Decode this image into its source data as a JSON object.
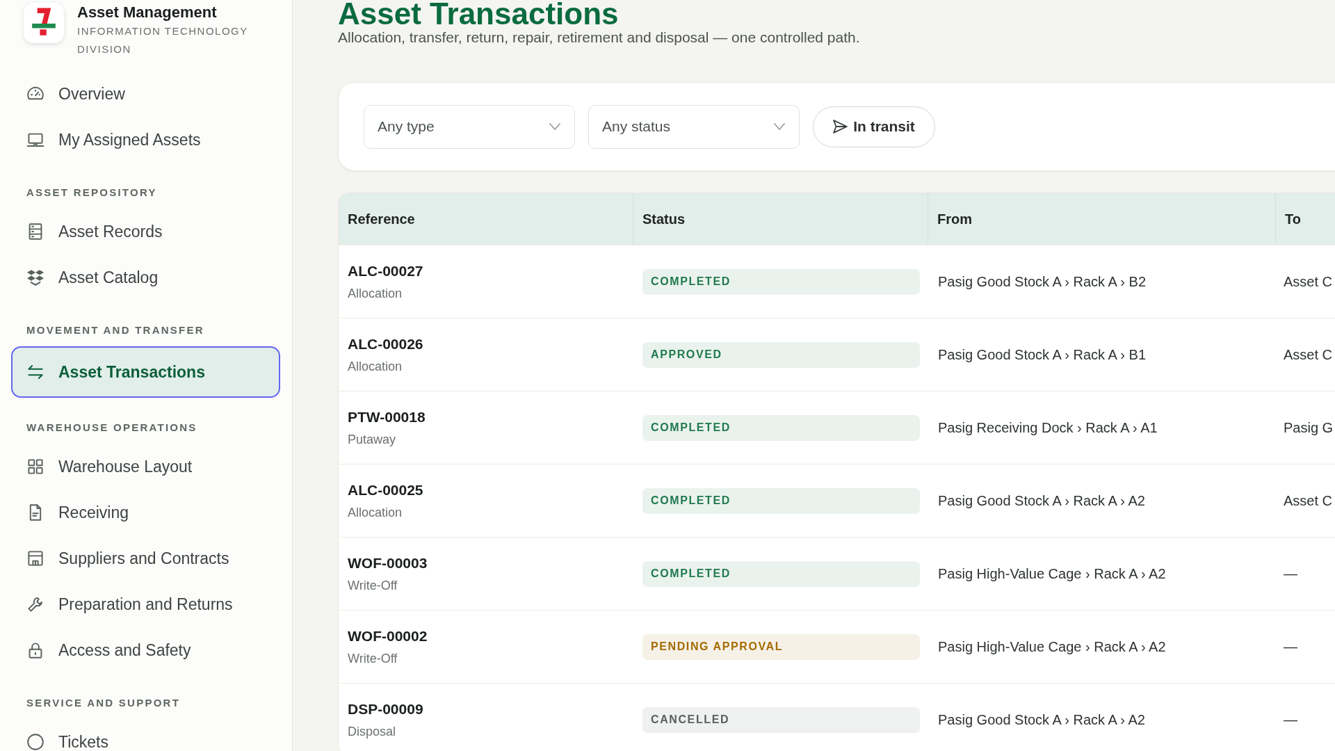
{
  "sidebar": {
    "brand": {
      "title": "Asset Management",
      "subtitle": "INFORMATION TECHNOLOGY DIVISION"
    },
    "groups": [
      {
        "items": [
          {
            "label": "Overview",
            "selected": false
          },
          {
            "label": "My Assigned Assets",
            "selected": false
          }
        ]
      },
      {
        "heading": "ASSET REPOSITORY",
        "items": [
          {
            "label": "Asset Records",
            "selected": false
          },
          {
            "label": "Asset Catalog",
            "selected": false
          }
        ]
      },
      {
        "heading": "MOVEMENT AND TRANSFER",
        "items": [
          {
            "label": "Asset Transactions",
            "selected": true
          }
        ]
      },
      {
        "heading": "WAREHOUSE OPERATIONS",
        "items": [
          {
            "label": "Warehouse Layout",
            "selected": false
          },
          {
            "label": "Receiving",
            "selected": false
          },
          {
            "label": "Suppliers and Contracts",
            "selected": false
          },
          {
            "label": "Preparation and Returns",
            "selected": false
          },
          {
            "label": "Access and Safety",
            "selected": false
          }
        ]
      },
      {
        "heading": "SERVICE AND SUPPORT",
        "items": [
          {
            "label": "Tickets",
            "selected": false
          }
        ]
      }
    ]
  },
  "page": {
    "title": "Asset Transactions",
    "subtitle": "Allocation, transfer, return, repair, retirement and disposal — one controlled path."
  },
  "filters": {
    "type_select": {
      "value": "Any type"
    },
    "status_select": {
      "value": "Any status"
    },
    "in_transit_button": {
      "label": "In transit"
    }
  },
  "table": {
    "columns": [
      "Reference",
      "Status",
      "From",
      "To"
    ],
    "rows": [
      {
        "reference": "ALC-00027",
        "type": "Allocation",
        "status": "COMPLETED",
        "color": "#1f7a4c",
        "from": "Pasig Good Stock A › Rack A › B2",
        "to": "Asset C"
      },
      {
        "reference": "ALC-00026",
        "type": "Allocation",
        "status": "APPROVED",
        "color": "#1f7a4c",
        "from": "Pasig Good Stock A › Rack A › B1",
        "to": "Asset C"
      },
      {
        "reference": "PTW-00018",
        "type": "Putaway",
        "status": "COMPLETED",
        "color": "#1f7a4c",
        "from": "Pasig Receiving Dock › Rack A › A1",
        "to": "Pasig G"
      },
      {
        "reference": "ALC-00025",
        "type": "Allocation",
        "status": "COMPLETED",
        "color": "#1f7a4c",
        "from": "Pasig Good Stock A › Rack A › A2",
        "to": "Asset C"
      },
      {
        "reference": "WOF-00003",
        "type": "Write-Off",
        "status": "COMPLETED",
        "color": "#1f7a4c",
        "from": "Pasig High-Value Cage › Rack A › A2",
        "to": "—"
      },
      {
        "reference": "WOF-00002",
        "type": "Write-Off",
        "status": "PENDING APPROVAL",
        "color": "#a36a00",
        "from": "Pasig High-Value Cage › Rack A › A2",
        "to": "—"
      },
      {
        "reference": "DSP-00009",
        "type": "Disposal",
        "status": "CANCELLED",
        "color": "#5a5f5c",
        "from": "Pasig Good Stock A › Rack A › A2",
        "to": "—"
      }
    ]
  }
}
